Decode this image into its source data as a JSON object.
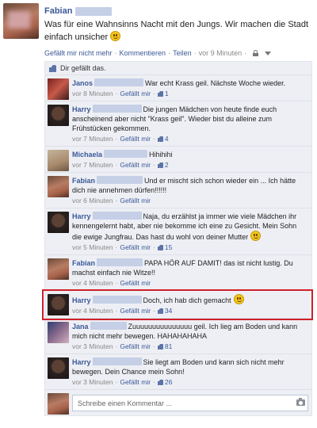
{
  "post": {
    "author": "Fabian",
    "text": "Was für eine Wahnsinns Nacht mit den Jungs. Wir machen die Stadt einfach unsicher",
    "actions": {
      "like": "Gefällt mir nicht mehr",
      "comment": "Kommentieren",
      "share": "Teilen",
      "time": "vor 9 Minuten"
    },
    "likes_text": "Dir gefällt das."
  },
  "comments": [
    {
      "author": "Janos",
      "text": "War echt Krass geil. Nächste Woche wieder.",
      "time": "vor 8 Minuten",
      "like": "Gefällt mir",
      "likes": "1",
      "avatar": "janos"
    },
    {
      "author": "Harry",
      "text": "Die jungen Mädchen von heute finde euch anscheinend aber nicht \"Krass geil\". Wieder bist du alleine zum Frühstücken gekommen.",
      "time": "vor 7 Minuten",
      "like": "Gefällt mir",
      "likes": "4",
      "avatar": "harry"
    },
    {
      "author": "Michaela",
      "text": "Hihihihi",
      "time": "vor 7 Minuten",
      "like": "Gefällt mir",
      "likes": "2",
      "avatar": "michaela"
    },
    {
      "author": "Fabian",
      "text": "Und er mischt sich schon wieder ein ... Ich hätte dich nie annehmen dürfen!!!!!!",
      "time": "vor 6 Minuten",
      "like": "Gefällt mir",
      "likes": "",
      "avatar": "fabian"
    },
    {
      "author": "Harry",
      "text": "Naja, du erzählst ja immer wie viele Mädchen ihr kennengelernt habt, aber nie bekomme ich eine zu Gesicht. Mein Sohn die ewige Jungfrau. Das hast du wohl von deiner Mutter",
      "time": "vor 5 Minuten",
      "like": "Gefällt mir",
      "likes": "15",
      "avatar": "harry",
      "smiley": true
    },
    {
      "author": "Fabian",
      "text": "PAPA HÖR AUF DAMIT! das ist nicht lustig. Du machst einfach nie Witze!!",
      "time": "vor 4 Minuten",
      "like": "Gefällt mir",
      "likes": "",
      "avatar": "fabian"
    },
    {
      "author": "Harry",
      "text": "Doch, ich hab dich gemacht",
      "time": "vor 4 Minuten",
      "like": "Gefällt mir",
      "likes": "34",
      "avatar": "harry",
      "smiley": true
    },
    {
      "author": "Jana",
      "text": "Zuuuuuuuuuuuuuuu geil. Ich lieg am Boden und kann mich nicht mehr bewegen. HAHAHAHAHA",
      "time": "vor 3 Minuten",
      "like": "Gefällt mir",
      "likes": "81",
      "avatar": "jana"
    },
    {
      "author": "Harry",
      "text": "Sie liegt am Boden und kann sich nicht mehr bewegen. Dein Chance mein Sohn!",
      "time": "vor 3 Minuten",
      "like": "Gefällt mir",
      "likes": "26",
      "avatar": "harry"
    }
  ],
  "composer": {
    "placeholder": "Schreibe einen Kommentar ..."
  },
  "icons": [
    "smiley-icon",
    "thumbs-up-icon",
    "lock-icon",
    "caret-down-icon",
    "camera-icon"
  ],
  "colors": {
    "link": "#3b5998",
    "thread_bg": "#edeff4",
    "highlight": "#d0202a"
  }
}
